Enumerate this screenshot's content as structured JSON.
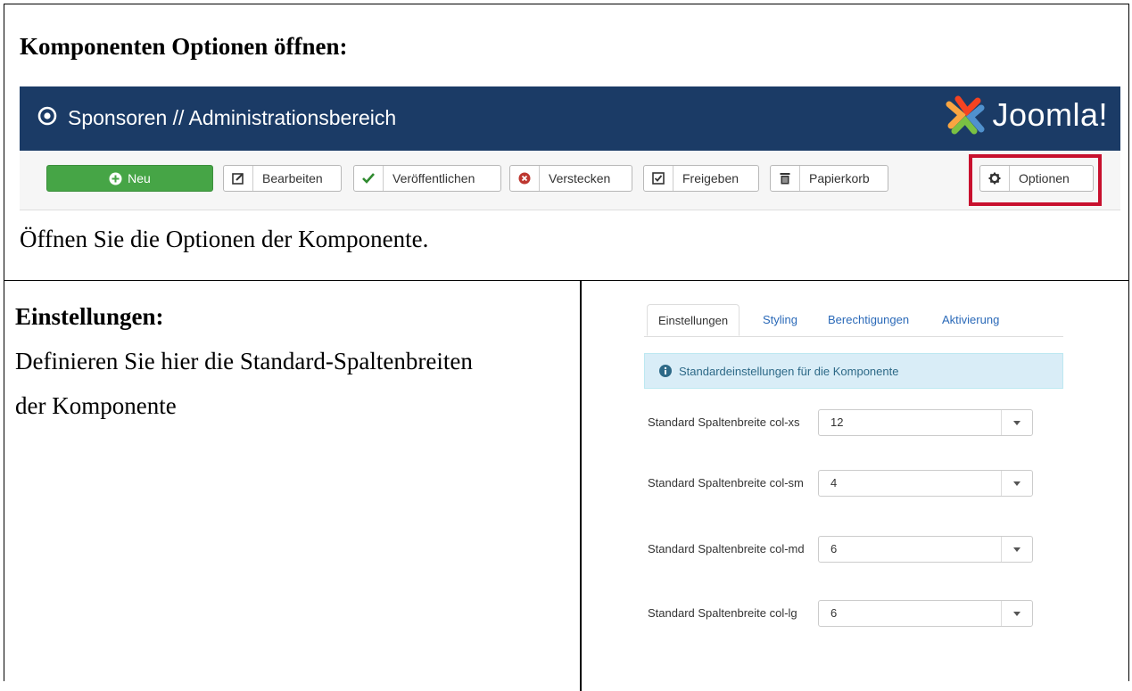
{
  "section1": {
    "heading": "Komponenten Optionen öffnen:",
    "caption": "Öffnen Sie die Optionen der Komponente."
  },
  "joomla": {
    "header_title": "Sponsoren // Administrationsbereich",
    "logo_text": "Joomla!",
    "header_color": "#1b3b66",
    "toolbar": {
      "new_label": "Neu",
      "edit_label": "Bearbeiten",
      "publish_label": "Veröffentlichen",
      "hide_label": "Verstecken",
      "approve_label": "Freigeben",
      "trash_label": "Papierkorb",
      "options_label": "Optionen"
    },
    "highlight_color": "#c8102e"
  },
  "section2": {
    "heading": "Einstellungen:",
    "text_line1": "Definieren Sie hier die Standard-Spaltenbreiten",
    "text_line2": "der Komponente"
  },
  "options_panel": {
    "tabs": [
      "Einstellungen",
      "Styling",
      "Berechtigungen",
      "Aktivierung"
    ],
    "info_text": "Standardeinstellungen für die Komponente",
    "fields": [
      {
        "label": "Standard Spaltenbreite col-xs",
        "value": "12"
      },
      {
        "label": "Standard Spaltenbreite col-sm",
        "value": "4"
      },
      {
        "label": "Standard Spaltenbreite col-md",
        "value": "6"
      },
      {
        "label": "Standard Spaltenbreite col-lg",
        "value": "6"
      }
    ]
  }
}
